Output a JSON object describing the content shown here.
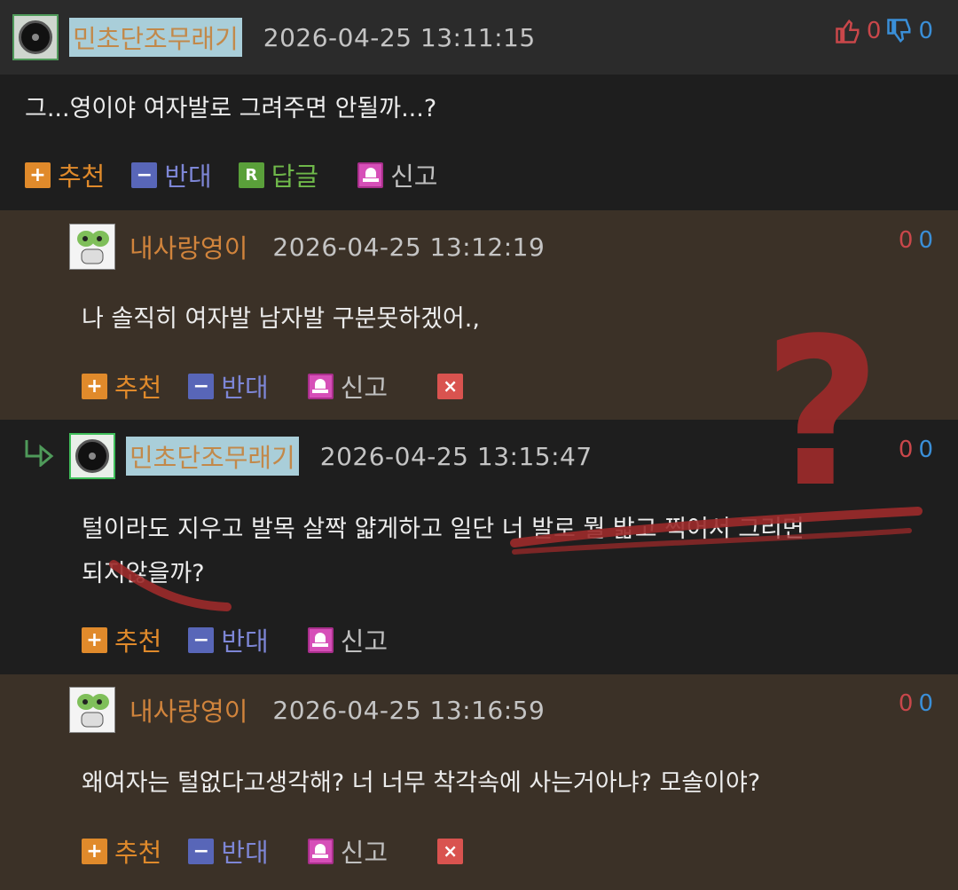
{
  "colors": {
    "accent_orange": "#e08a2b",
    "vote_red": "#c9474a",
    "vote_blue": "#3a8fd8",
    "nick_highlight_bg": "#a9ced9",
    "reply_bg": "#3b3127",
    "dark_bg": "#1e1e1e",
    "scribble_red": "#9c2a2a"
  },
  "actions": {
    "recommend": "추천",
    "oppose": "반대",
    "reply": "답글",
    "report": "신고",
    "delete_icon": "×"
  },
  "comments": [
    {
      "nickname": "민초단조무래기",
      "timestamp": "2026-04-25 13:11:15",
      "upvotes": "0",
      "downvotes": "0",
      "text": "그...영이야 여자발로 그려주면 안될까...?",
      "avatar": "gauge-disk-avatar"
    },
    {
      "nickname": "내사랑영이",
      "timestamp": "2026-04-25 13:12:19",
      "upvotes": "0",
      "downvotes": "0",
      "text": "나 솔직히 여자발 남자발 구분못하겠어.,",
      "avatar": "frog-character-avatar"
    },
    {
      "nickname": "민초단조무래기",
      "timestamp": "2026-04-25 13:15:47",
      "upvotes": "0",
      "downvotes": "0",
      "text_line1": "털이라도 지우고 발목 살짝 얇게하고 일단 너 발로 뭘 밟고 찍어서 그리면",
      "text_line2": "되지않을까?",
      "avatar": "gauge-disk-avatar"
    },
    {
      "nickname": "내사랑영이",
      "timestamp": "2026-04-25 13:16:59",
      "upvotes": "0",
      "downvotes": "0",
      "text": "왜여자는 털없다고생각해? 너 너무 착각속에 사는거아냐? 모솔이야?",
      "avatar": "frog-character-avatar"
    }
  ],
  "annotation": {
    "question_mark": "?"
  }
}
